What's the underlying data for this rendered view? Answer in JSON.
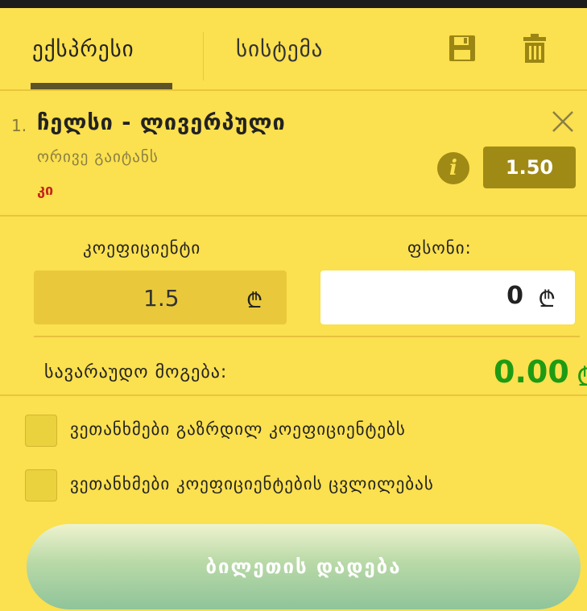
{
  "tabs": {
    "express_label": "ექსპრესი",
    "system_label": "სისტემა",
    "save_icon": "floppy-disk-icon",
    "trash_icon": "trash-icon"
  },
  "bet": {
    "index": "1.",
    "match": "ჩელსი - ლივერპული",
    "market": "ორივე გაიტანს",
    "pick": "კი",
    "odds": "1.50"
  },
  "form": {
    "odds_label": "კოეფიციენტი",
    "odds_value": "1.5",
    "stake_label": "ფსონი:",
    "stake_value": "0",
    "currency_symbol": "₾"
  },
  "summary": {
    "potential_win_label": "სავარაუდო მოგება:",
    "potential_win_value": "0.00",
    "currency_symbol": "₾"
  },
  "options": {
    "accept_increased_label": "ვეთანხმები გაზრდილ კოეფიციენტებს",
    "accept_changes_label": "ვეთანხმები კოეფიციენტების ცვლილებას"
  },
  "submit": {
    "label": "ბილეთის დადება"
  },
  "colors": {
    "background": "#fbe04f",
    "accent_dark": "#a08a16",
    "win_green": "#1f9a13",
    "pick_red": "#c3271b"
  }
}
